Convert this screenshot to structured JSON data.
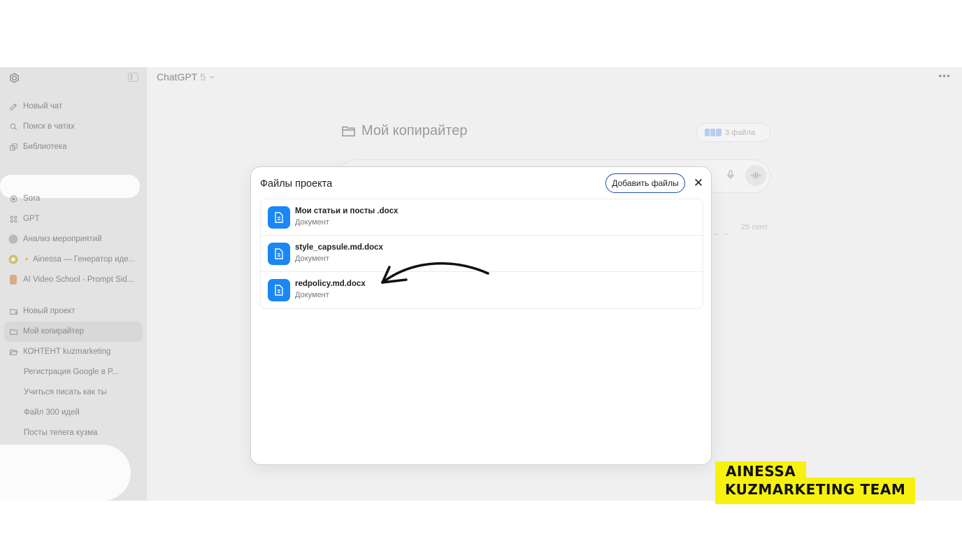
{
  "header": {
    "model_name": "ChatGPT",
    "model_version": "5",
    "more_icon": "more-dots-icon"
  },
  "sidebar": {
    "top_items": [
      {
        "label": "Новый чат",
        "icon": "edit-icon"
      },
      {
        "label": "Поиск в чатах",
        "icon": "search-icon"
      },
      {
        "label": "Библиотека",
        "icon": "library-icon"
      },
      {
        "label": "Sora",
        "icon": "sora-icon"
      },
      {
        "label": "GPT",
        "icon": "grid-icon"
      }
    ],
    "gpts": [
      {
        "label": "Анализ мероприятий"
      },
      {
        "label": "Ainessa — Генератор иде..."
      },
      {
        "label": "AI Video School - Prompt Sid..."
      }
    ],
    "projects": [
      {
        "label": "Новый проект",
        "icon": "new-folder-icon"
      },
      {
        "label": "Мой копирайтер",
        "icon": "folder-icon"
      },
      {
        "label": "КОНТЕНТ kuzmarketing",
        "icon": "folder-open-icon"
      }
    ],
    "sub_chats": [
      {
        "label": "Регистрация Google в Р..."
      },
      {
        "label": "Учиться писать как ты"
      },
      {
        "label": "Файл 300 идей"
      },
      {
        "label": "Посты телега кузма"
      }
    ]
  },
  "project": {
    "title": "Мой копирайтер",
    "files_chip": "3 файла",
    "chat_date": "25 сент."
  },
  "modal": {
    "title": "Файлы проекта",
    "add_button": "Добавить файлы",
    "files": [
      {
        "name": "Мои статьи и посты .docx",
        "type": "Документ"
      },
      {
        "name": "style_capsule.md.docx",
        "type": "Документ"
      },
      {
        "name": "redpolicy.md.docx",
        "type": "Документ"
      }
    ]
  },
  "watermark": {
    "line1": "AINESSA",
    "line2": "KUZMARKETING TEAM",
    "color": "#f6f20e"
  },
  "colors": {
    "file_icon": "#1a87f5",
    "add_button_border": "#1e4fa8",
    "app_bg": "#f0f0f0",
    "sidebar_bg": "#e3e3e3"
  }
}
